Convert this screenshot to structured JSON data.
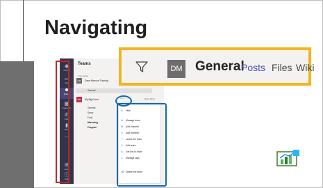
{
  "slide": {
    "title": "Navigating"
  },
  "teams_panel": {
    "title": "Teams",
    "section_label": "Your teams",
    "rail": [
      {
        "icon": "bell-icon",
        "label": "Activity"
      },
      {
        "icon": "chat-icon",
        "label": "Chat"
      },
      {
        "icon": "teams-icon",
        "label": "Teams"
      },
      {
        "icon": "calendar-icon",
        "label": "Calendar"
      },
      {
        "icon": "phone-icon",
        "label": "Calls"
      },
      {
        "icon": "files-icon",
        "label": "Files"
      },
      {
        "icon": "more-icon",
        "label": "..."
      },
      {
        "icon": "apps-icon",
        "label": "Apps"
      },
      {
        "icon": "help-icon",
        "label": "Help"
      }
    ],
    "teams": [
      {
        "initials": "DM",
        "name": "Dave Mcevoe Training",
        "color": "#6d6d6d",
        "channels": [
          "General"
        ]
      },
      {
        "initials": "MB",
        "name": "My Big Event",
        "color": "#c4314b",
        "channels": [
          "General",
          "Decor",
          "Food",
          "Marketing",
          "Program"
        ]
      }
    ],
    "header_snippet": "Dave Mcev"
  },
  "context_menu": {
    "items": [
      {
        "icon": "eye-off-icon",
        "label": "Hide"
      },
      {
        "icon": "gear-icon",
        "label": "Manage team"
      },
      {
        "icon": "add-channel-icon",
        "label": "Add channel"
      },
      {
        "icon": "add-member-icon",
        "label": "Add member"
      },
      {
        "icon": "leave-icon",
        "label": "Leave the team"
      },
      {
        "icon": "pencil-icon",
        "label": "Edit team"
      },
      {
        "icon": "link-icon",
        "label": "Get link to team"
      },
      {
        "icon": "tag-icon",
        "label": "Manage tags"
      },
      {
        "icon": "trash-icon",
        "label": "Delete the team"
      }
    ]
  },
  "channel_header": {
    "avatar_initials": "DM",
    "channel_name": "General",
    "tabs": [
      "Posts",
      "Files",
      "Wiki"
    ],
    "active_tab_color": "#464eb8"
  },
  "callout_colors": {
    "red": "#c0281e",
    "blue": "#1566b0",
    "yellow": "#f2b51f"
  }
}
